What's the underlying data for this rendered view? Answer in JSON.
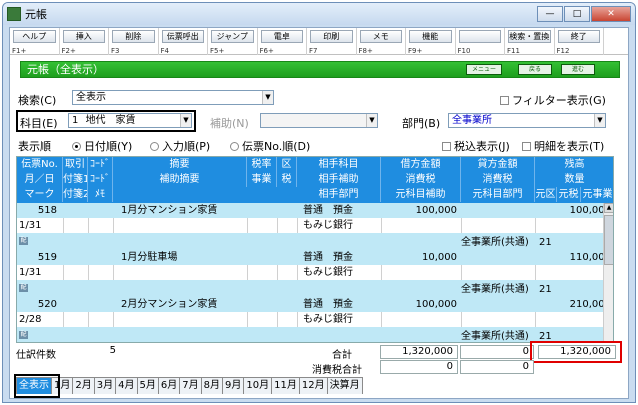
{
  "window": {
    "title": "元帳"
  },
  "fkeys": [
    {
      "label": "ヘルプ",
      "fn": "F1+"
    },
    {
      "label": "挿入",
      "fn": "F2+"
    },
    {
      "label": "削除",
      "fn": "F3"
    },
    {
      "label": "伝票呼出",
      "fn": "F4"
    },
    {
      "label": "ジャンプ",
      "fn": "F5+"
    },
    {
      "label": "電卓",
      "fn": "F6+"
    },
    {
      "label": "印刷",
      "fn": "F7"
    },
    {
      "label": "メモ",
      "fn": "F8+"
    },
    {
      "label": "機能",
      "fn": "F9+"
    },
    {
      "label": "",
      "fn": "F10"
    },
    {
      "label": "検索・置換",
      "fn": "F11"
    },
    {
      "label": "終了",
      "fn": "F12"
    }
  ],
  "banner": {
    "title": "元帳（全表示）",
    "btn_menu": "メニュー",
    "btn_back": "戻る",
    "btn_next": "進む"
  },
  "search": {
    "label": "検索(C)",
    "value": "全表示"
  },
  "filter": {
    "label": "フィルター表示(G)"
  },
  "account": {
    "label": "科目(E)",
    "code": "1",
    "value": "地代　家賃"
  },
  "sub": {
    "label": "補助(N)"
  },
  "dept": {
    "label": "部門(B)",
    "value": "全事業所"
  },
  "order": {
    "label": "表示順",
    "opt1": "日付順(Y)",
    "opt2": "入力順(P)",
    "opt3": "伝票No.順(D)"
  },
  "tax": {
    "label": "税込表示(J)"
  },
  "detail": {
    "label": "明細を表示(T)"
  },
  "header": {
    "r1": [
      "伝票No.",
      "取引",
      "ｺｰﾄﾞ",
      "摘要",
      "税率",
      "区",
      "相手科目",
      "借方金額",
      "貸方金額",
      "残高"
    ],
    "r2": [
      "月／日",
      "付箋1",
      "ｺｰﾄﾞ",
      "補助摘要",
      "事業",
      "税",
      "相手補助",
      "消費税",
      "消費税",
      "数量"
    ],
    "r3": [
      "マーク",
      "付箋2",
      "ﾒﾓ",
      "相手部門",
      "元科目補助",
      "元科目部門",
      "元区",
      "元税",
      "元事業"
    ]
  },
  "rows": [
    {
      "no": "518",
      "date": "1/31",
      "desc": "1月分マンション家賃",
      "acct": "普通　預金",
      "subacct": "もみじ銀行",
      "debit": "100,000",
      "balance": "100,000",
      "dept": "全事業所(共通)",
      "code": "21"
    },
    {
      "no": "519",
      "date": "1/31",
      "desc": "1月分駐車場",
      "acct": "普通　預金",
      "subacct": "もみじ銀行",
      "debit": "10,000",
      "balance": "110,000",
      "dept": "全事業所(共通)",
      "code": "21"
    },
    {
      "no": "520",
      "date": "2/28",
      "desc": "2月分マンション家賃",
      "acct": "普通　預金",
      "subacct": "もみじ銀行",
      "debit": "100,000",
      "balance": "210,000",
      "dept": "全事業所(共通)",
      "code": "21"
    }
  ],
  "memo_mark": "配",
  "footer": {
    "count_label": "仕訳件数",
    "count": "5",
    "total_label": "合計",
    "debit_total": "1,320,000",
    "credit_total": "0",
    "balance_total": "1,320,000",
    "tax_label": "消費税合計",
    "tax_debit": "0",
    "tax_credit": "0"
  },
  "tabs": [
    "全表示",
    "1月",
    "2月",
    "3月",
    "4月",
    "5月",
    "6月",
    "7月",
    "8月",
    "9月",
    "10月",
    "11月",
    "12月",
    "決算月"
  ]
}
